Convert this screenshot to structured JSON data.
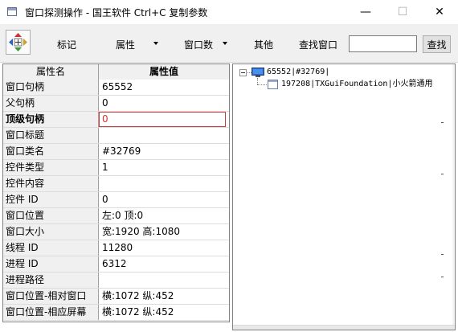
{
  "window": {
    "title": "窗口探测操作 - 国王软件 Ctrl+C 复制参数",
    "minimize_glyph": "—",
    "maximize_glyph": "☐",
    "close_glyph": "✕"
  },
  "toolbar": {
    "target_icon": "crosshair-target-icon",
    "mark_label": "标记",
    "property_label": "属性",
    "window_count_label": "窗口数",
    "other_label": "其他",
    "find_window_label": "查找窗口",
    "search_value": "",
    "search_button_label": "查找"
  },
  "property_grid": {
    "header_name": "属性名",
    "header_value": "属性值",
    "rows": [
      {
        "name": "窗口句柄",
        "value": "65552"
      },
      {
        "name": "父句柄",
        "value": "0"
      },
      {
        "name": "顶级句柄",
        "value": "0"
      },
      {
        "name": "窗口标题",
        "value": ""
      },
      {
        "name": "窗口类名",
        "value": "#32769"
      },
      {
        "name": "控件类型",
        "value": "1"
      },
      {
        "name": "控件内容",
        "value": ""
      },
      {
        "name": "控件 ID",
        "value": "0"
      },
      {
        "name": "窗口位置",
        "value": "左:0 顶:0"
      },
      {
        "name": "窗口大小",
        "value": "宽:1920 高:1080"
      },
      {
        "name": "线程 ID",
        "value": "11280"
      },
      {
        "name": "进程 ID",
        "value": "6312"
      },
      {
        "name": "进程路径",
        "value": ""
      },
      {
        "name": "窗口位置-相对窗口",
        "value": "横:1072 纵:452"
      },
      {
        "name": "窗口位置-相应屏幕",
        "value": "横:1072 纵:452"
      }
    ]
  },
  "tree": {
    "root_label": "65552|#32769|",
    "child_label": "197208|TXGuiFoundation|小火箭通用"
  },
  "colors": {
    "accent_red": "#e03030",
    "grid_header_bg": "#f0f0f0"
  }
}
